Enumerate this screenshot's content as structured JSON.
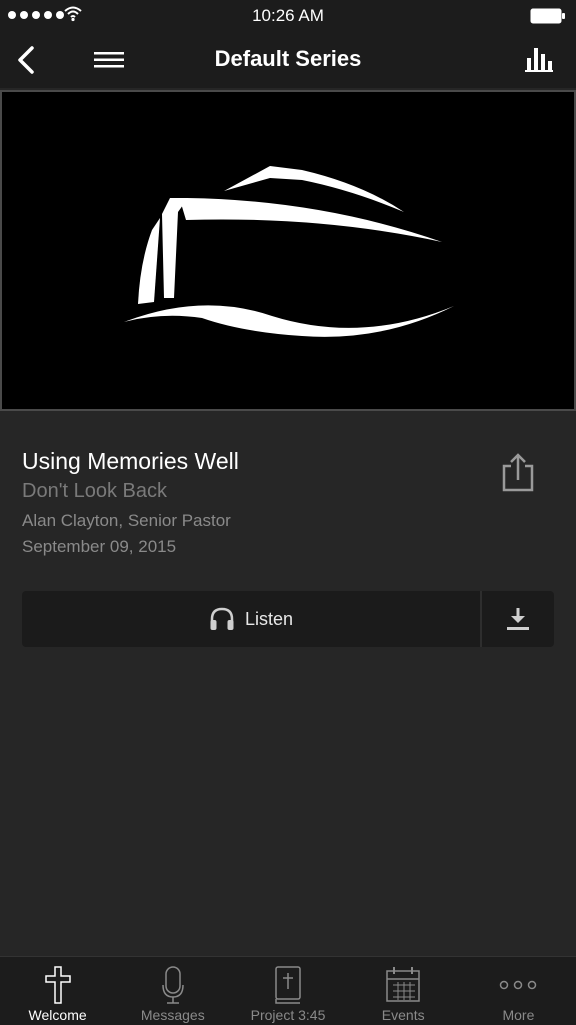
{
  "status_bar": {
    "time": "10:26 AM",
    "icons": [
      "signal-dots",
      "wifi-icon",
      "battery-icon"
    ]
  },
  "nav": {
    "title": "Default Series",
    "left_icons": [
      "back-chevron-icon",
      "hamburger-menu-icon"
    ],
    "right_icon": "bar-chart-icon"
  },
  "artwork": {
    "description_icon": "ark-logo"
  },
  "sermon": {
    "title": "Using Memories Well",
    "series": "Don't Look Back",
    "speaker": "Alan Clayton, Senior Pastor",
    "date": "September 09, 2015",
    "share_icon": "share-icon"
  },
  "actions": {
    "listen_label": "Listen",
    "listen_icon": "headphones-icon",
    "download_icon": "download-icon"
  },
  "tabs": [
    {
      "label": "Welcome",
      "icon": "cross-icon",
      "active": true
    },
    {
      "label": "Messages",
      "icon": "microphone-icon",
      "active": false
    },
    {
      "label": "Project 3:45",
      "icon": "bible-icon",
      "active": false
    },
    {
      "label": "Events",
      "icon": "calendar-icon",
      "active": false
    },
    {
      "label": "More",
      "icon": "more-dots-icon",
      "active": false
    }
  ],
  "colors": {
    "background": "#262626",
    "bars": "#1c1c1c",
    "text_primary": "#ffffff",
    "text_secondary": "#8a8a8a"
  }
}
